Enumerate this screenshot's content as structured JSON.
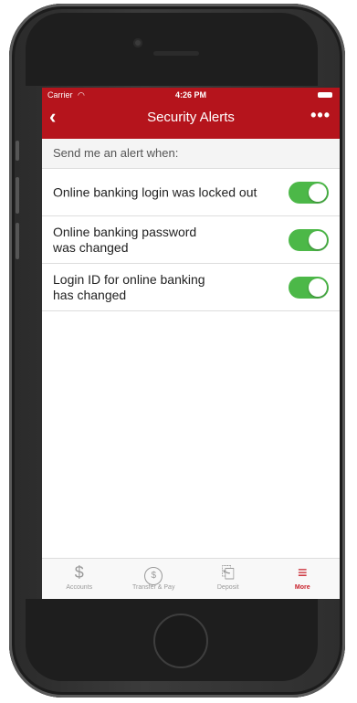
{
  "status_bar": {
    "carrier": "Carrier",
    "time": "4:26 PM"
  },
  "nav": {
    "back_icon": "chevron-left-icon",
    "title": "Security Alerts",
    "more_icon": "ellipsis-icon"
  },
  "section": {
    "header": "Send me an alert when:"
  },
  "alerts": [
    {
      "label": "Online banking login was locked out",
      "enabled": true
    },
    {
      "label": "Online banking password was changed",
      "enabled": true
    },
    {
      "label": "Login ID for online banking has changed",
      "enabled": true
    }
  ],
  "tabs": [
    {
      "label": "Accounts",
      "icon": "dollar-icon",
      "active": false
    },
    {
      "label": "Transfer & Pay",
      "icon": "transfer-icon",
      "active": false
    },
    {
      "label": "Deposit",
      "icon": "check-deposit-icon",
      "active": false
    },
    {
      "label": "More",
      "icon": "menu-icon",
      "active": true
    }
  ],
  "colors": {
    "header": "#b5141c",
    "toggle_on": "#4cb848",
    "active_tab": "#c8202a"
  }
}
